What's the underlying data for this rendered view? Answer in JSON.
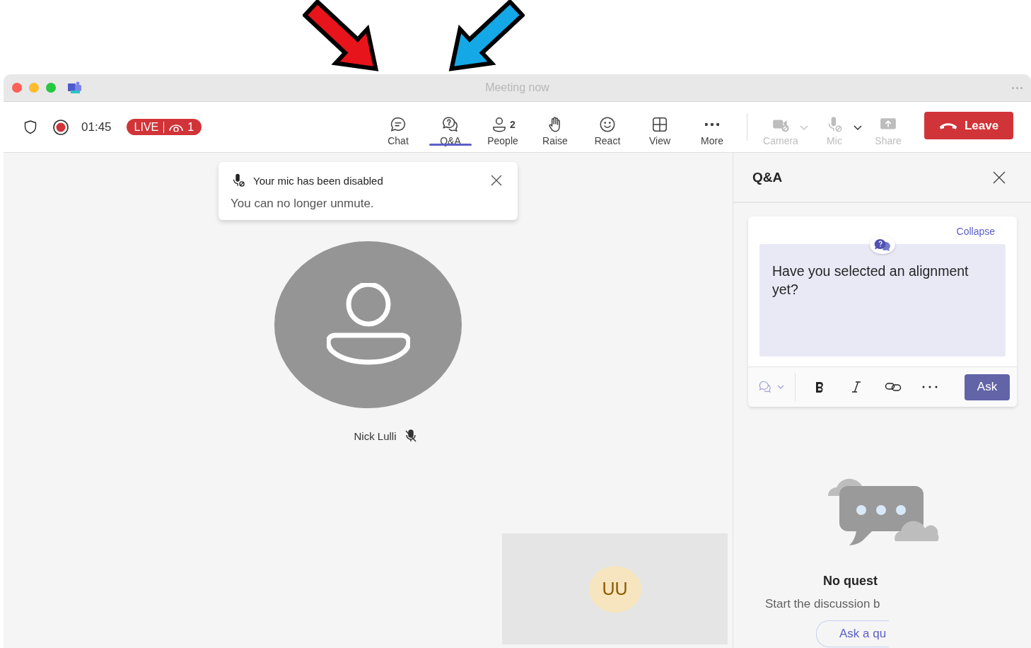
{
  "annotations": [
    {
      "color": "#e8141b"
    },
    {
      "color": "#15a8e6"
    }
  ],
  "window": {
    "title": "Meeting now"
  },
  "meeting_bar": {
    "timer": "01:45",
    "live": {
      "label": "LIVE",
      "viewers": "1"
    }
  },
  "toolbar": [
    {
      "kind": "chat",
      "label": "Chat",
      "selected": false,
      "disabled": false
    },
    {
      "kind": "qa",
      "label": "Q&A",
      "selected": true,
      "disabled": false
    },
    {
      "kind": "people",
      "label": "People",
      "count": "2",
      "selected": false,
      "disabled": false
    },
    {
      "kind": "raise",
      "label": "Raise",
      "selected": false,
      "disabled": false
    },
    {
      "kind": "react",
      "label": "React",
      "selected": false,
      "disabled": false
    },
    {
      "kind": "view",
      "label": "View",
      "selected": false,
      "disabled": false
    },
    {
      "kind": "more",
      "label": "More",
      "selected": false,
      "disabled": false
    },
    {
      "kind": "camera",
      "label": "Camera",
      "selected": false,
      "disabled": true,
      "caret_disabled": true
    },
    {
      "kind": "mic",
      "label": "Mic",
      "selected": false,
      "disabled": true,
      "caret_disabled": false
    },
    {
      "kind": "share",
      "label": "Share",
      "selected": false,
      "disabled": true
    }
  ],
  "leave_button": {
    "label": "Leave"
  },
  "notification": {
    "title": "Your mic has been disabled",
    "body": "You can no longer unmute."
  },
  "participant": {
    "name": "Nick Lulli",
    "muted": true
  },
  "self_view": {
    "initials": "UU"
  },
  "qa_panel": {
    "title": "Q&A",
    "collapse": "Collapse",
    "question": {
      "value": "Have you selected an alignment yet?"
    },
    "ask_button": "Ask",
    "empty_state": {
      "title": "No quest",
      "text": "Start the discussion b",
      "button": "Ask a qu"
    }
  }
}
